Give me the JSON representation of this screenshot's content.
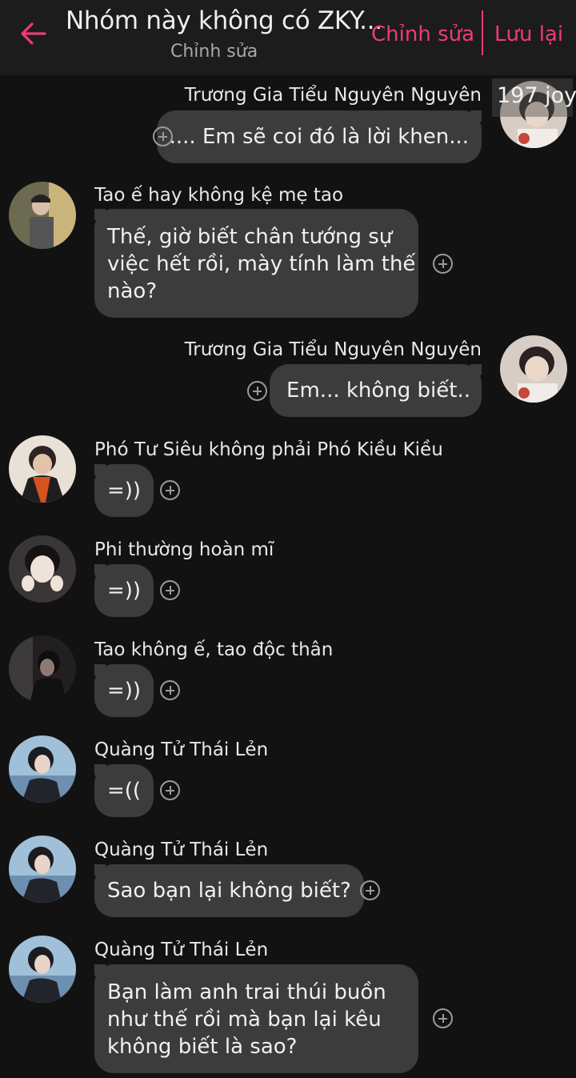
{
  "header": {
    "title": "Nhóm này không có ZKY...",
    "subtitle": "Chỉnh sửa",
    "edit_label": "Chỉnh sửa",
    "save_label": "Lưu lại",
    "accent_color": "#ec3c78",
    "back_icon": "arrow-left-icon"
  },
  "overlay_badge": "197 joy",
  "messages": [
    {
      "side": "right",
      "sender": "Trương Gia Tiểu Nguyên Nguyên",
      "text": ".... Em sẽ coi đó là lời khen..."
    },
    {
      "side": "left",
      "sender": "Tao ế hay không kệ mẹ tao",
      "lines": [
        "Thế, giờ biết chân tướng sự",
        "việc hết rồi, mày tính làm thế",
        "nào?"
      ]
    },
    {
      "side": "right",
      "sender": "Trương Gia Tiểu Nguyên Nguyên",
      "text": "Em... không biết.."
    },
    {
      "side": "left",
      "sender": "Phó Tư Siêu không phải Phó Kiều Kiều",
      "text": "=))"
    },
    {
      "side": "left",
      "sender": "Phi thường hoàn mĩ",
      "text": "=))"
    },
    {
      "side": "left",
      "sender": "Tao không ế, tao độc thân",
      "text": "=))"
    },
    {
      "side": "left",
      "sender": "Quàng Tử Thái Lẻn",
      "text": "=(("
    },
    {
      "side": "left",
      "sender": "Quàng Tử Thái Lẻn",
      "text": "Sao bạn lại không biết?"
    },
    {
      "side": "left",
      "sender": "Quàng Tử Thái Lẻn",
      "lines": [
        "Bạn làm anh trai thúi buồn",
        "như thế rồi mà bạn lại kêu",
        "không biết là sao?"
      ]
    }
  ]
}
